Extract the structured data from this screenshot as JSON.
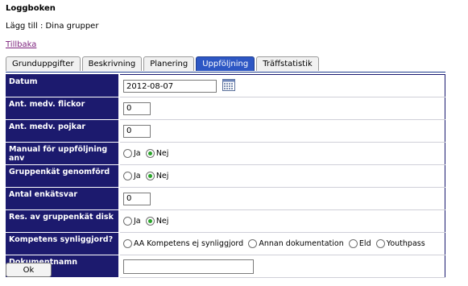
{
  "header": {
    "title": "Loggboken",
    "subtitle": "Lägg till : Dina grupper",
    "back_link": "Tillbaka"
  },
  "tabs": [
    {
      "label": "Grunduppgifter",
      "active": false
    },
    {
      "label": "Beskrivning",
      "active": false
    },
    {
      "label": "Planering",
      "active": false
    },
    {
      "label": "Uppföljning",
      "active": true
    },
    {
      "label": "Träffstatistik",
      "active": false
    }
  ],
  "form": {
    "datum": {
      "label": "Datum",
      "value": "2012-08-07"
    },
    "flickor": {
      "label": "Ant. medv. flickor",
      "value": "0"
    },
    "pojkar": {
      "label": "Ant. medv. pojkar",
      "value": "0"
    },
    "manual": {
      "label": "Manual för uppföljning anv",
      "options": [
        "Ja",
        "Nej"
      ],
      "selected": "Nej"
    },
    "gruppenkat": {
      "label": "Gruppenkät genomförd",
      "options": [
        "Ja",
        "Nej"
      ],
      "selected": "Nej"
    },
    "enkatsvar": {
      "label": "Antal enkätsvar",
      "value": "0"
    },
    "disk": {
      "label": "Res. av gruppenkät disk",
      "options": [
        "Ja",
        "Nej"
      ],
      "selected": "Nej"
    },
    "kompetens": {
      "label": "Kompetens synliggjord?",
      "options": [
        "AA Kompetens ej synliggjord",
        "Annan dokumentation",
        "Eld",
        "Youthpass"
      ],
      "selected": ""
    },
    "dokumentnamn": {
      "label": "Dokumentnamn",
      "value": ""
    }
  },
  "ok_button": "Ok",
  "colors": {
    "label_bg": "#1c1a6e",
    "active_tab": "#2d57c4",
    "radio_checked": "#2aa42a",
    "link": "#7b1f7b"
  },
  "icons": {
    "calendar": "calendar-icon"
  }
}
